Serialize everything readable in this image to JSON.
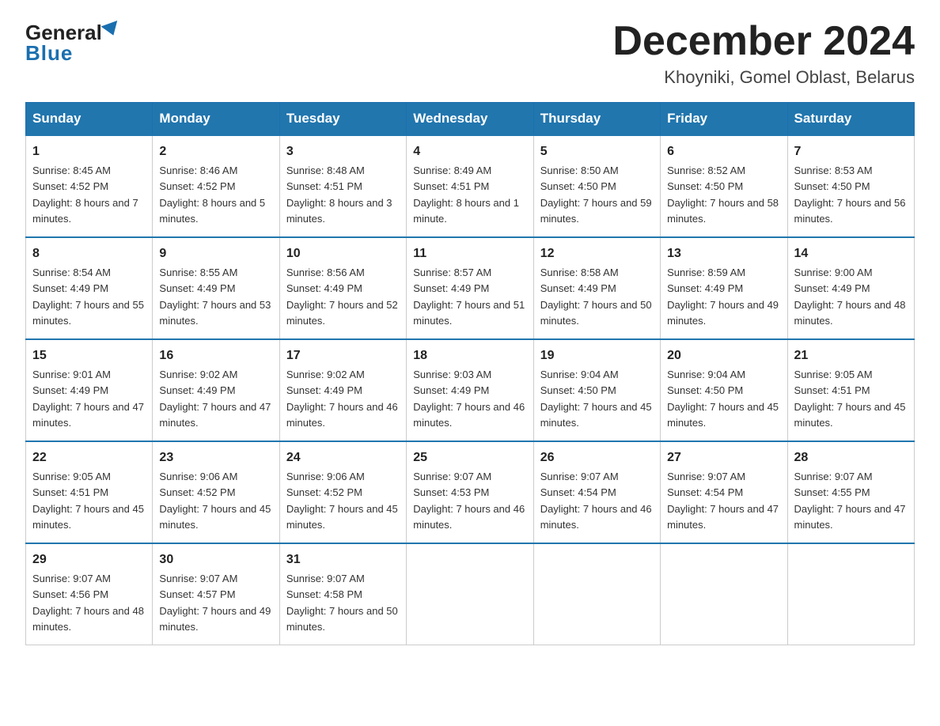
{
  "header": {
    "logo_general": "General",
    "logo_blue": "Blue",
    "month_title": "December 2024",
    "location": "Khoyniki, Gomel Oblast, Belarus"
  },
  "days_of_week": [
    "Sunday",
    "Monday",
    "Tuesday",
    "Wednesday",
    "Thursday",
    "Friday",
    "Saturday"
  ],
  "weeks": [
    [
      {
        "day": "1",
        "sunrise": "8:45 AM",
        "sunset": "4:52 PM",
        "daylight": "8 hours and 7 minutes."
      },
      {
        "day": "2",
        "sunrise": "8:46 AM",
        "sunset": "4:52 PM",
        "daylight": "8 hours and 5 minutes."
      },
      {
        "day": "3",
        "sunrise": "8:48 AM",
        "sunset": "4:51 PM",
        "daylight": "8 hours and 3 minutes."
      },
      {
        "day": "4",
        "sunrise": "8:49 AM",
        "sunset": "4:51 PM",
        "daylight": "8 hours and 1 minute."
      },
      {
        "day": "5",
        "sunrise": "8:50 AM",
        "sunset": "4:50 PM",
        "daylight": "7 hours and 59 minutes."
      },
      {
        "day": "6",
        "sunrise": "8:52 AM",
        "sunset": "4:50 PM",
        "daylight": "7 hours and 58 minutes."
      },
      {
        "day": "7",
        "sunrise": "8:53 AM",
        "sunset": "4:50 PM",
        "daylight": "7 hours and 56 minutes."
      }
    ],
    [
      {
        "day": "8",
        "sunrise": "8:54 AM",
        "sunset": "4:49 PM",
        "daylight": "7 hours and 55 minutes."
      },
      {
        "day": "9",
        "sunrise": "8:55 AM",
        "sunset": "4:49 PM",
        "daylight": "7 hours and 53 minutes."
      },
      {
        "day": "10",
        "sunrise": "8:56 AM",
        "sunset": "4:49 PM",
        "daylight": "7 hours and 52 minutes."
      },
      {
        "day": "11",
        "sunrise": "8:57 AM",
        "sunset": "4:49 PM",
        "daylight": "7 hours and 51 minutes."
      },
      {
        "day": "12",
        "sunrise": "8:58 AM",
        "sunset": "4:49 PM",
        "daylight": "7 hours and 50 minutes."
      },
      {
        "day": "13",
        "sunrise": "8:59 AM",
        "sunset": "4:49 PM",
        "daylight": "7 hours and 49 minutes."
      },
      {
        "day": "14",
        "sunrise": "9:00 AM",
        "sunset": "4:49 PM",
        "daylight": "7 hours and 48 minutes."
      }
    ],
    [
      {
        "day": "15",
        "sunrise": "9:01 AM",
        "sunset": "4:49 PM",
        "daylight": "7 hours and 47 minutes."
      },
      {
        "day": "16",
        "sunrise": "9:02 AM",
        "sunset": "4:49 PM",
        "daylight": "7 hours and 47 minutes."
      },
      {
        "day": "17",
        "sunrise": "9:02 AM",
        "sunset": "4:49 PM",
        "daylight": "7 hours and 46 minutes."
      },
      {
        "day": "18",
        "sunrise": "9:03 AM",
        "sunset": "4:49 PM",
        "daylight": "7 hours and 46 minutes."
      },
      {
        "day": "19",
        "sunrise": "9:04 AM",
        "sunset": "4:50 PM",
        "daylight": "7 hours and 45 minutes."
      },
      {
        "day": "20",
        "sunrise": "9:04 AM",
        "sunset": "4:50 PM",
        "daylight": "7 hours and 45 minutes."
      },
      {
        "day": "21",
        "sunrise": "9:05 AM",
        "sunset": "4:51 PM",
        "daylight": "7 hours and 45 minutes."
      }
    ],
    [
      {
        "day": "22",
        "sunrise": "9:05 AM",
        "sunset": "4:51 PM",
        "daylight": "7 hours and 45 minutes."
      },
      {
        "day": "23",
        "sunrise": "9:06 AM",
        "sunset": "4:52 PM",
        "daylight": "7 hours and 45 minutes."
      },
      {
        "day": "24",
        "sunrise": "9:06 AM",
        "sunset": "4:52 PM",
        "daylight": "7 hours and 45 minutes."
      },
      {
        "day": "25",
        "sunrise": "9:07 AM",
        "sunset": "4:53 PM",
        "daylight": "7 hours and 46 minutes."
      },
      {
        "day": "26",
        "sunrise": "9:07 AM",
        "sunset": "4:54 PM",
        "daylight": "7 hours and 46 minutes."
      },
      {
        "day": "27",
        "sunrise": "9:07 AM",
        "sunset": "4:54 PM",
        "daylight": "7 hours and 47 minutes."
      },
      {
        "day": "28",
        "sunrise": "9:07 AM",
        "sunset": "4:55 PM",
        "daylight": "7 hours and 47 minutes."
      }
    ],
    [
      {
        "day": "29",
        "sunrise": "9:07 AM",
        "sunset": "4:56 PM",
        "daylight": "7 hours and 48 minutes."
      },
      {
        "day": "30",
        "sunrise": "9:07 AM",
        "sunset": "4:57 PM",
        "daylight": "7 hours and 49 minutes."
      },
      {
        "day": "31",
        "sunrise": "9:07 AM",
        "sunset": "4:58 PM",
        "daylight": "7 hours and 50 minutes."
      },
      null,
      null,
      null,
      null
    ]
  ]
}
